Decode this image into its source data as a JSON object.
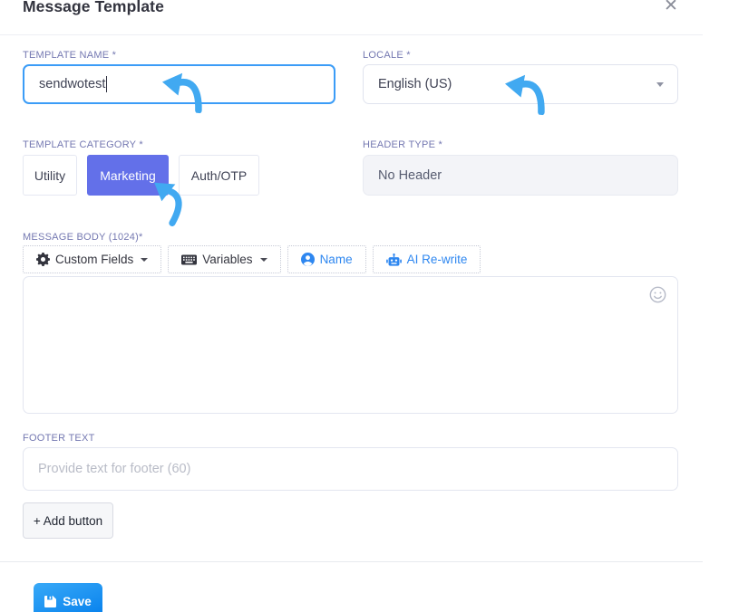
{
  "modal": {
    "title": "Message Template",
    "close_icon": "✕"
  },
  "template_name": {
    "label": "TEMPLATE NAME *",
    "value": "sendwotest"
  },
  "locale": {
    "label": "LOCALE *",
    "value": "English (US)"
  },
  "template_category": {
    "label": "TEMPLATE CATEGORY *",
    "options": [
      {
        "label": "Utility",
        "selected": false
      },
      {
        "label": "Marketing",
        "selected": true
      },
      {
        "label": "Auth/OTP",
        "selected": false
      }
    ]
  },
  "header_type": {
    "label": "HEADER TYPE *",
    "value": "No Header",
    "disabled": true
  },
  "message_body": {
    "label": "MESSAGE BODY (1024)*",
    "value": "",
    "toolbar": {
      "custom_fields": "Custom Fields",
      "variables": "Variables",
      "name": "Name",
      "ai_rewrite": "AI Re-write"
    }
  },
  "footer_text": {
    "label": "FOOTER TEXT",
    "value": "",
    "placeholder": "Provide text for footer (60)"
  },
  "actions": {
    "add_button": "+ Add button",
    "save": "Save"
  },
  "colors": {
    "accent_blue": "#2e87f0",
    "category_selected_bg": "#6370e9",
    "focused_input_border": "#3b9cf7",
    "label_color": "#7478b1",
    "annotation_arrow": "#41a9f1",
    "save_gradient_start": "#38a9f7",
    "save_gradient_end": "#0c85ee",
    "disabled_field_bg": "#f3f4f8"
  }
}
